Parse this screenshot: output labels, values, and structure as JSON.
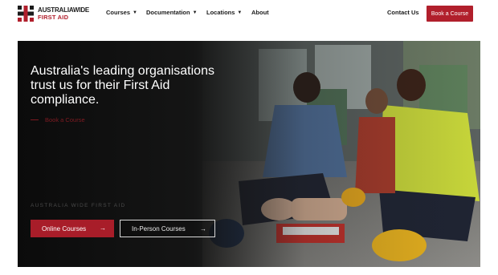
{
  "brand": {
    "name_line1": "AUSTRALIAWIDE",
    "name_line2": "FIRST AID",
    "accent": "#b11f2c"
  },
  "nav": {
    "items": [
      {
        "label": "Courses",
        "has_dropdown": true
      },
      {
        "label": "Documentation",
        "has_dropdown": true
      },
      {
        "label": "Locations",
        "has_dropdown": true
      },
      {
        "label": "About",
        "has_dropdown": false
      }
    ],
    "contact_label": "Contact Us",
    "book_label": "Book a Course",
    "caret_icon": "chevron-down-icon"
  },
  "hero": {
    "title": "Australia's leading organisations trust us for their First Aid compliance.",
    "link_label": "Book a Course",
    "kicker": "AUSTRALIA WIDE FIRST AID",
    "online_label": "Online Courses",
    "inperson_label": "In-Person Courses",
    "arrow_icon": "arrow-right-icon"
  }
}
